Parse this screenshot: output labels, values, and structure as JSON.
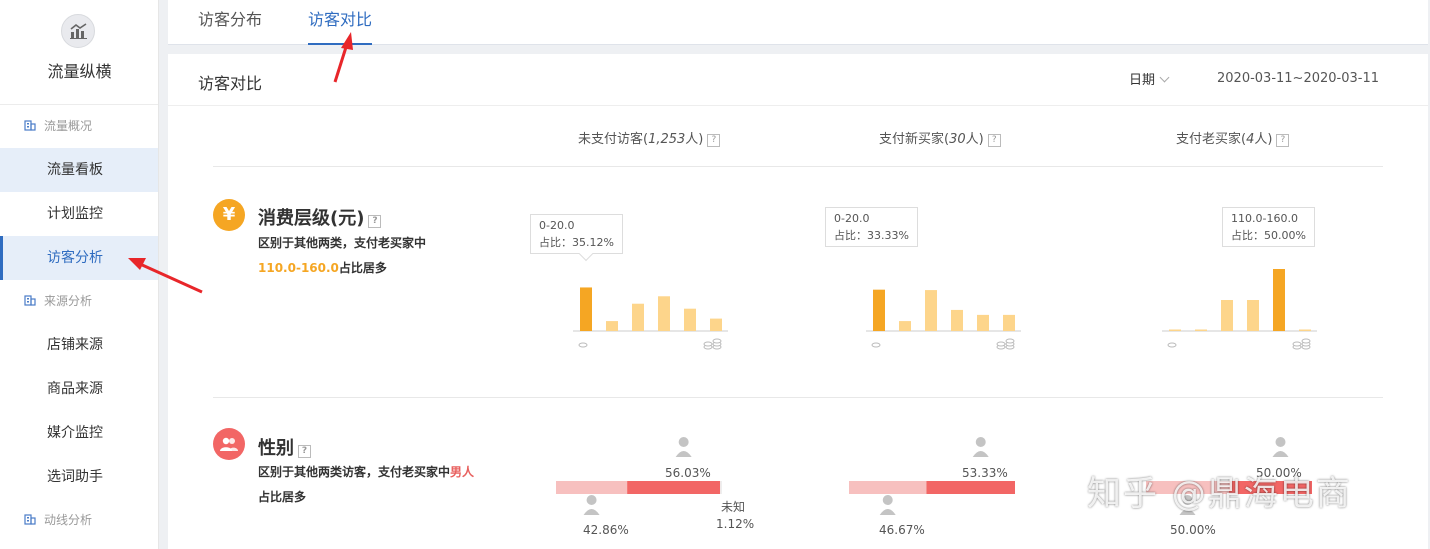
{
  "sidebar": {
    "logo_title": "流量纵横",
    "groups": [
      {
        "label": "流量概况",
        "items": [
          {
            "label": "流量看板"
          },
          {
            "label": "计划监控"
          },
          {
            "label": "访客分析"
          }
        ]
      },
      {
        "label": "来源分析",
        "items": [
          {
            "label": "店铺来源"
          },
          {
            "label": "商品来源"
          },
          {
            "label": "媒介监控"
          },
          {
            "label": "选词助手"
          }
        ]
      },
      {
        "label": "动线分析",
        "items": []
      }
    ]
  },
  "tabs": [
    {
      "label": "访客分布"
    },
    {
      "label": "访客对比"
    }
  ],
  "panel": {
    "title": "访客对比",
    "date_label": "日期",
    "date_range": "2020-03-11~2020-03-11"
  },
  "columns": [
    {
      "prefix": "未支付访客(",
      "count": "1,253",
      "suffix": "人)"
    },
    {
      "prefix": "支付新买家(",
      "count": "30",
      "suffix": "人)"
    },
    {
      "prefix": "支付老买家(",
      "count": "4",
      "suffix": "人)"
    }
  ],
  "consumption": {
    "title": "消费层级(元)",
    "icon": "yen-icon",
    "desc_1": "区别于其他两类，支付老买家中",
    "desc_highlight": "110.0-160.0",
    "desc_2": "占比居多",
    "charts": [
      {
        "tip_range": "0-20.0",
        "tip_ratio": "占比：35.12%",
        "bars": [
          35.12,
          8,
          22,
          28,
          18,
          10
        ],
        "highlight": 0
      },
      {
        "tip_range": "0-20.0",
        "tip_ratio": "占比：33.33%",
        "bars": [
          33.33,
          8,
          33,
          17,
          13,
          13
        ],
        "highlight": 0
      },
      {
        "tip_range": "110.0-160.0",
        "tip_ratio": "占比：50.00%",
        "bars": [
          0.8,
          0.8,
          25,
          25,
          50,
          1
        ],
        "highlight": 4
      }
    ]
  },
  "gender": {
    "title": "性别",
    "icon": "users-icon",
    "desc_1": "区别于其他两类访客，支付老买家中",
    "desc_highlight": "男人",
    "desc_2": "占比居多",
    "charts": [
      {
        "male": "56.03%",
        "female": "42.86%",
        "unknown_label": "未知",
        "unknown": "1.12%",
        "male_frac": 0.5603,
        "female_frac": 0.4286
      },
      {
        "male": "53.33%",
        "female": "46.67%",
        "male_frac": 0.5333,
        "female_frac": 0.4667
      },
      {
        "male": "50.00%",
        "female": "50.00%",
        "male_frac": 0.5,
        "female_frac": 0.5
      }
    ]
  },
  "watermark": "知乎 @鼎海电商",
  "colors": {
    "accent": "#2f6cc0",
    "bar_highlight": "#f5a623",
    "bar_light": "#fdd58b",
    "gender_dark": "#f26665",
    "gender_light": "#f7c0bf",
    "annotation": "#e8262a"
  }
}
